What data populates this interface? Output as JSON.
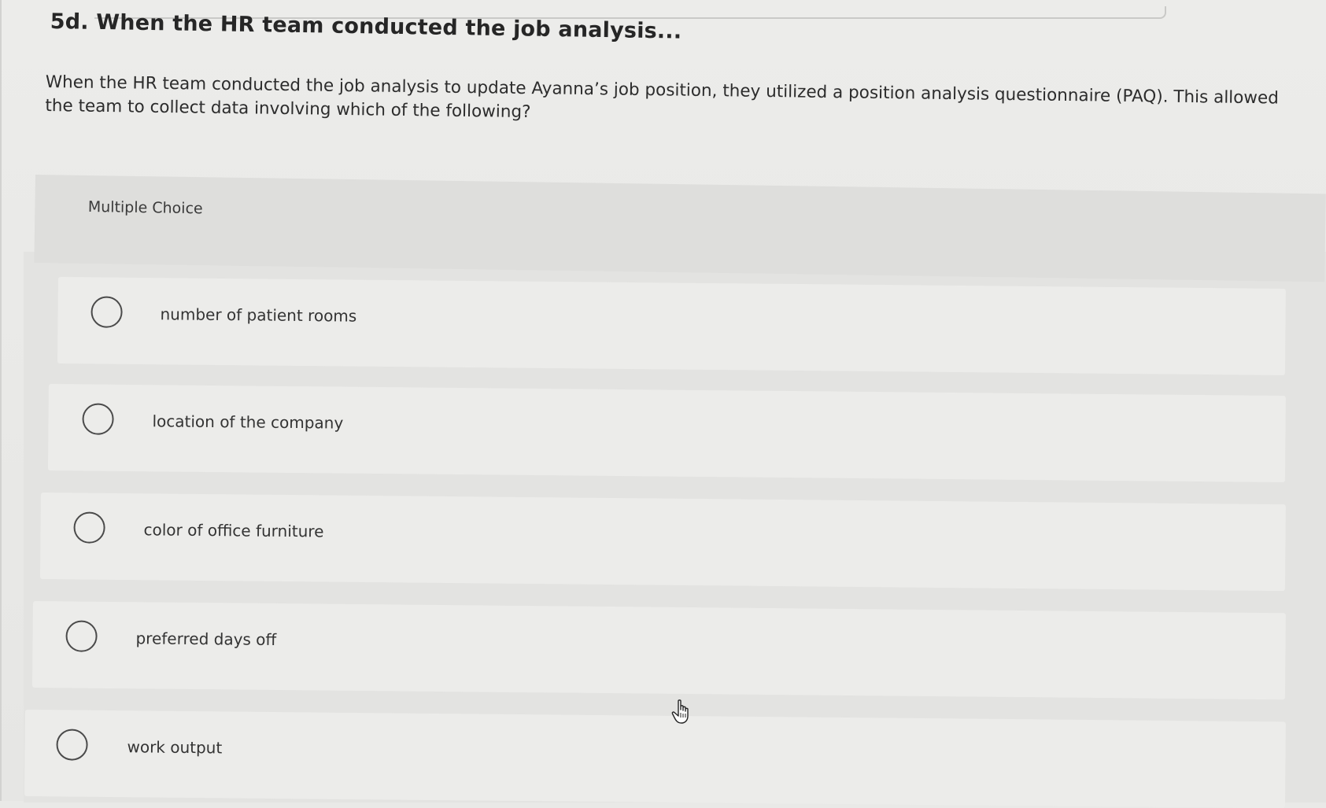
{
  "question": {
    "title": "5d. When the HR team conducted the job analysis...",
    "text": "When the HR team conducted the job analysis to update Ayanna’s job position, they utilized a position analysis questionnaire (PAQ). This allowed the team to collect data involving which of the following?"
  },
  "multiple_choice": {
    "header": "Multiple Choice",
    "options": [
      {
        "label": "number of patient rooms",
        "selected": false
      },
      {
        "label": "location of the company",
        "selected": false
      },
      {
        "label": "color of office furniture",
        "selected": false
      },
      {
        "label": "preferred days off",
        "selected": false
      },
      {
        "label": "work output",
        "selected": false
      }
    ]
  },
  "icons": {
    "cursor": "hand-pointer-icon"
  }
}
